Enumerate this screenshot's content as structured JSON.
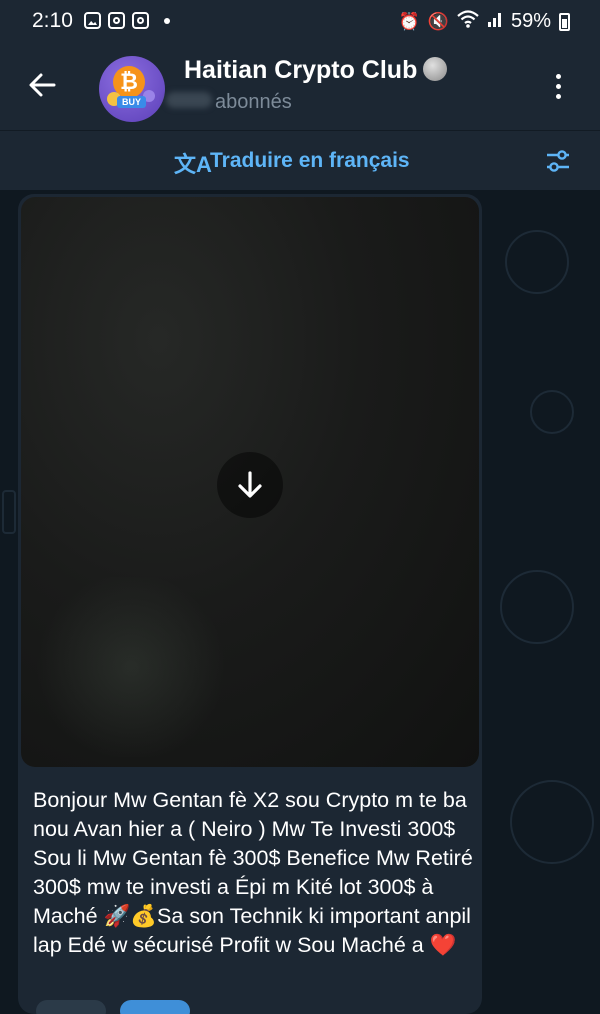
{
  "status_bar": {
    "time": "2:10",
    "battery": "59%",
    "icons": [
      "gallery-icon",
      "instagram-icon",
      "instagram-icon",
      "alarm-icon",
      "mute-icon",
      "wifi-icon",
      "signal-icon",
      "battery-icon"
    ]
  },
  "header": {
    "title": "Haitian Crypto Club",
    "subtitle": "abonnés",
    "avatar_badge": "BUY"
  },
  "translate_bar": {
    "label": "Traduire en français"
  },
  "message": {
    "text": "Bonjour Mw Gentan fè X2 sou Crypto m te ba nou Avan hier a  ( Neiro ) Mw Te Investi 300$ Sou li  Mw Gentan fè 300$ Benefice Mw Retiré 300$ mw te investi a Épi m Kité lot 300$ à Maché 🚀💰Sa son Technik ki important anpil lap Edé w sécurisé Profit w Sou Maché a ❤️"
  },
  "colors": {
    "header_bg": "#1c2733",
    "chat_bg": "#0f1820",
    "accent": "#5eb5f7",
    "bitcoin": "#f6931a"
  }
}
